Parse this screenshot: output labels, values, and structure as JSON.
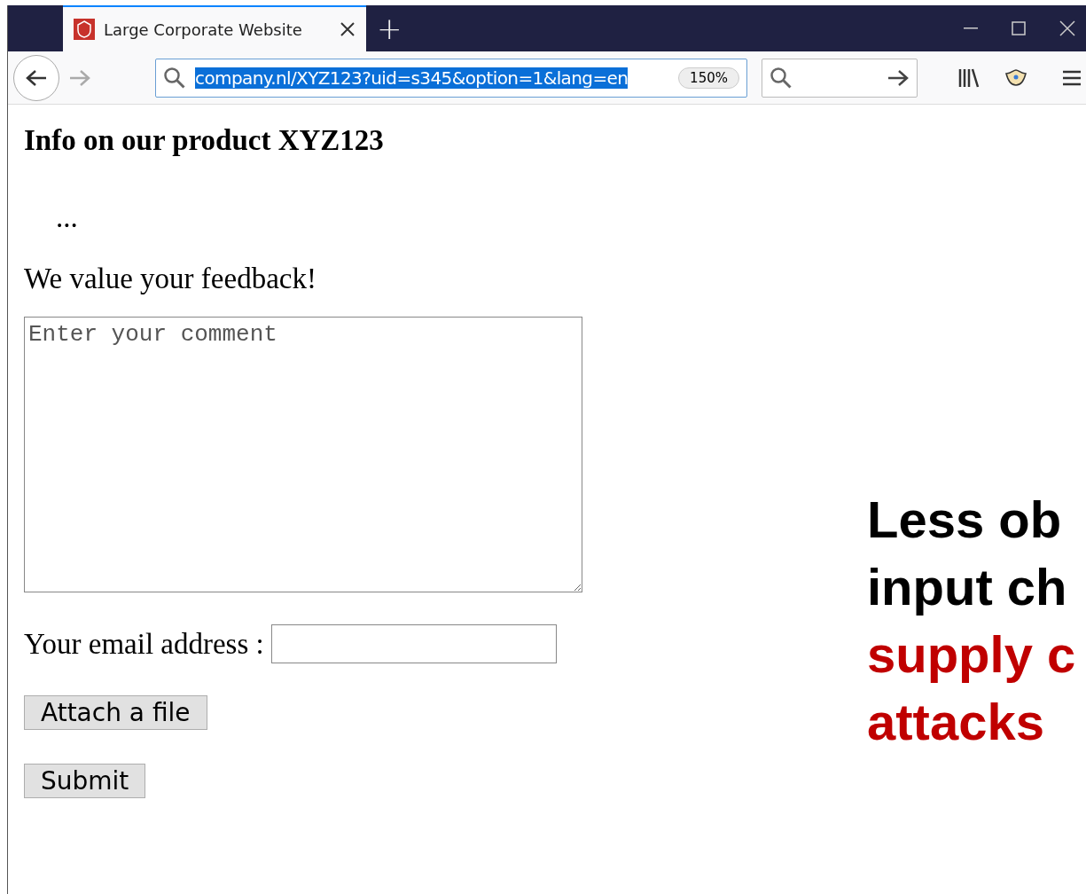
{
  "tabs": [
    {
      "title": "Large Corporate Website",
      "selected": true
    }
  ],
  "new_tab": "+",
  "toolbar": {
    "url": "company.nl/XYZ123?uid=s345&option=1&lang=en",
    "url_selected": true,
    "zoom": "150%"
  },
  "page": {
    "heading": "Info on our product XYZ123",
    "ellipsis": "...",
    "feedback_prompt": "We value your feedback!",
    "comment": {
      "placeholder": "Enter your comment"
    },
    "email_label": "Your email address :",
    "buttons": [
      "Attach a file",
      "Submit"
    ]
  },
  "overlay": {
    "lines": [
      {
        "text": "Less ob",
        "kind": "plain"
      },
      {
        "text": "input ch",
        "kind": "plain"
      },
      {
        "text": "supply c",
        "kind": "accent"
      },
      {
        "text": "attacks",
        "kind": "accent"
      }
    ]
  }
}
